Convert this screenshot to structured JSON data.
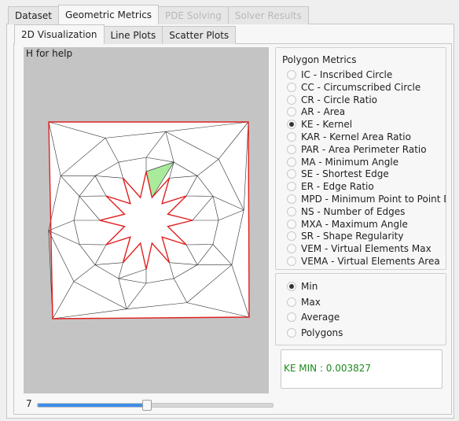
{
  "top_tabs": [
    {
      "label": "Dataset",
      "state": "normal"
    },
    {
      "label": "Geometric Metrics",
      "state": "active"
    },
    {
      "label": "PDE Solving",
      "state": "disabled"
    },
    {
      "label": "Solver Results",
      "state": "disabled"
    }
  ],
  "sub_tabs": [
    {
      "label": "2D Visualization",
      "state": "active"
    },
    {
      "label": "Line Plots",
      "state": "normal"
    },
    {
      "label": "Scatter Plots",
      "state": "normal"
    }
  ],
  "canvas": {
    "help_text": "H for help"
  },
  "metrics": {
    "title": "Polygon Metrics",
    "selected": "KE - Kernel",
    "options": [
      "IC - Inscribed Circle",
      "CC - Circumscribed Circle",
      "CR - Circle Ratio",
      "AR - Area",
      "KE - Kernel",
      "KAR - Kernel Area Ratio",
      "PAR - Area Perimeter Ratio",
      "MA - Minimum Angle",
      "SE - Shortest Edge",
      "ER - Edge Ratio",
      "MPD - Minimum Point to Point Distar",
      "NS - Number of Edges",
      "MXA - Maximum Angle",
      "SR - Shape Regularity",
      "VEM - Virtual Elements Max",
      "VEMA - Virtual Elements Area"
    ]
  },
  "statistics": {
    "selected": "Min",
    "options": [
      "Min",
      "Max",
      "Average",
      "Polygons"
    ]
  },
  "result": {
    "text": "KE MIN : 0.003827"
  },
  "slider": {
    "value": "7",
    "fraction": 0.46
  }
}
